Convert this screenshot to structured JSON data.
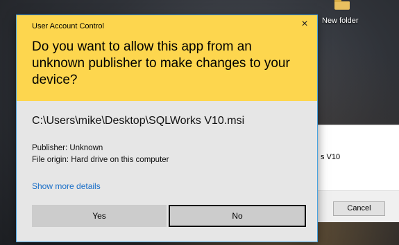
{
  "desktop": {
    "folder_label": "New folder"
  },
  "installer_window": {
    "text_fragment": "s V10",
    "cancel_label": "Cancel"
  },
  "uac": {
    "title": "User Account Control",
    "close_glyph": "×",
    "question": "Do you want to allow this app from an unknown publisher to make changes to your device?",
    "file_path": "C:\\Users\\mike\\Desktop\\SQLWorks V10.msi",
    "publisher_line": "Publisher: Unknown",
    "origin_line": "File origin: Hard drive on this computer",
    "show_more_label": "Show more details",
    "yes_label": "Yes",
    "no_label": "No",
    "header_color": "#fdd64e",
    "link_color": "#1a6fc8"
  },
  "icons": {
    "folder": "folder-icon",
    "close": "close-icon"
  }
}
